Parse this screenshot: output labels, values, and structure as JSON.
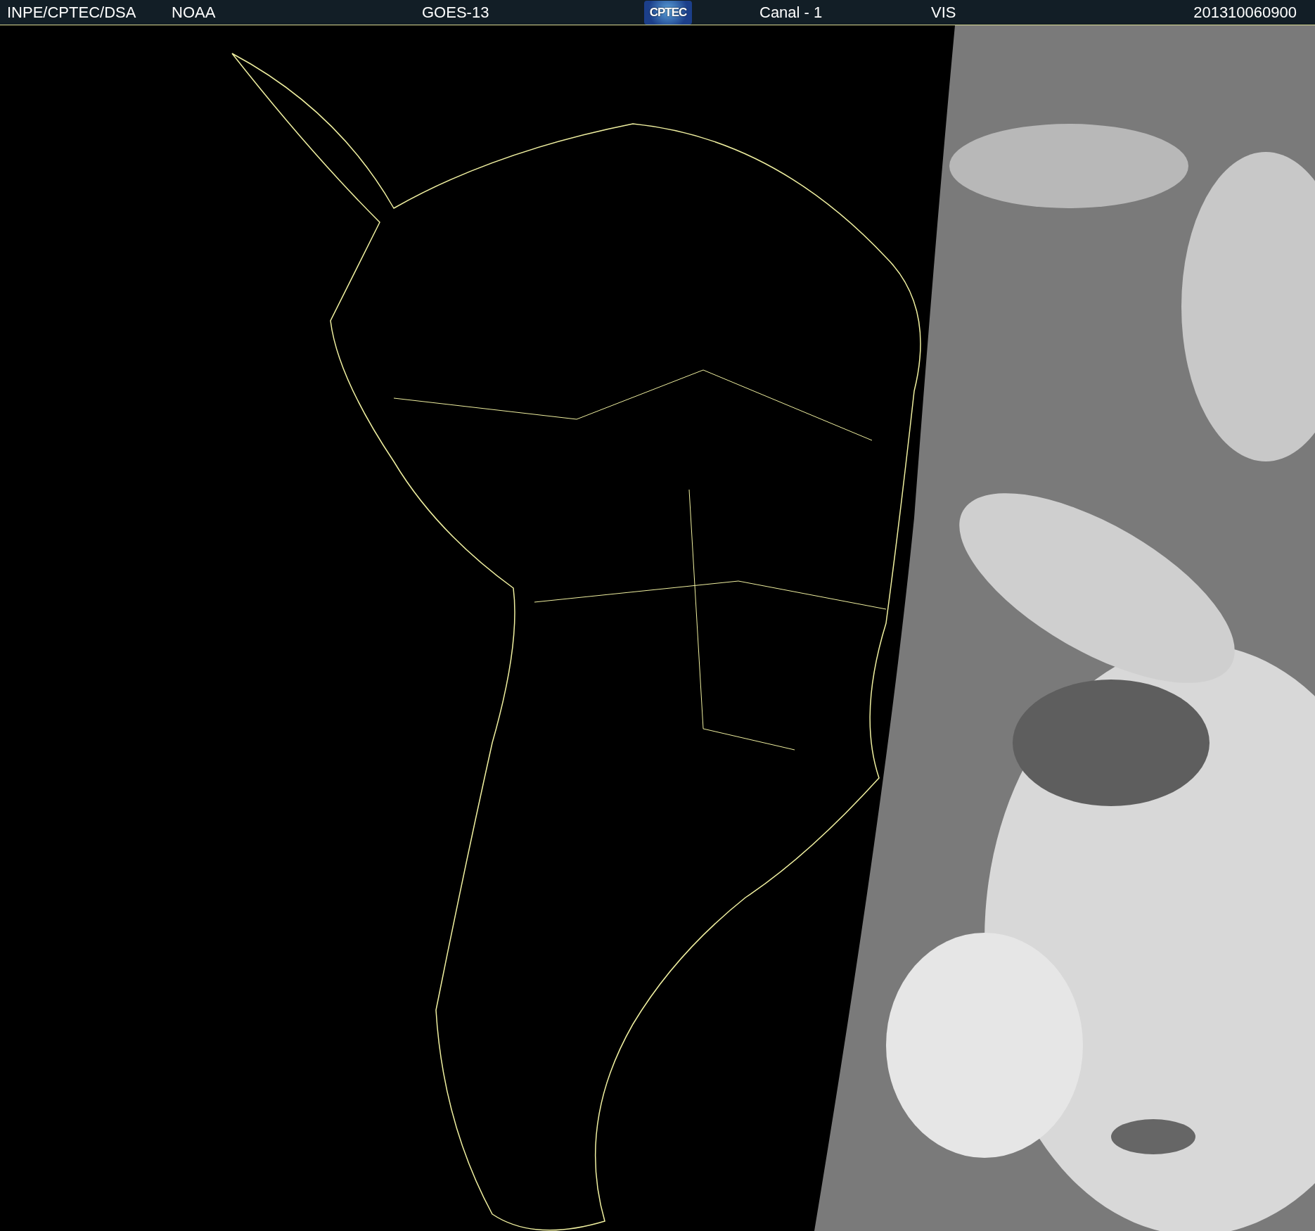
{
  "header": {
    "items": [
      {
        "kind": "text",
        "text": "INPE/CPTEC/DSA"
      },
      {
        "kind": "text",
        "text": "NOAA"
      },
      {
        "kind": "text",
        "text": "GOES-13"
      },
      {
        "kind": "logo",
        "text": "CPTEC"
      },
      {
        "kind": "text",
        "text": "Canal - 1"
      },
      {
        "kind": "text",
        "text": "VIS"
      },
      {
        "kind": "text",
        "text": "201310060900"
      }
    ]
  }
}
